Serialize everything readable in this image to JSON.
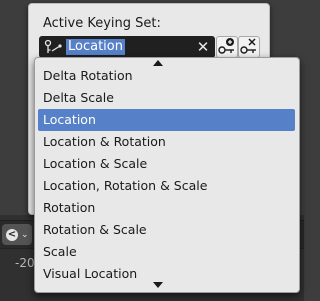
{
  "panel": {
    "title": "Active Keying Set:",
    "field_value": "Location",
    "clear_symbol": "✕"
  },
  "menu": {
    "items": [
      {
        "label": "Delta Rotation",
        "selected": false
      },
      {
        "label": "Delta Scale",
        "selected": false
      },
      {
        "label": "Location",
        "selected": true
      },
      {
        "label": "Location & Rotation",
        "selected": false
      },
      {
        "label": "Location & Scale",
        "selected": false
      },
      {
        "label": "Location, Rotation & Scale",
        "selected": false
      },
      {
        "label": "Rotation",
        "selected": false
      },
      {
        "label": "Rotation & Scale",
        "selected": false
      },
      {
        "label": "Scale",
        "selected": false
      },
      {
        "label": "Visual Location",
        "selected": false
      }
    ]
  },
  "timeline": {
    "frame_label": "-20"
  },
  "icons": {
    "keyset": "keying-set-icon",
    "add": "add-keyframe-icon",
    "remove": "remove-keyframe-icon"
  },
  "colors": {
    "accent": "#5681c8",
    "menu_bg": "#e8e8e8",
    "field_bg": "#202020"
  }
}
